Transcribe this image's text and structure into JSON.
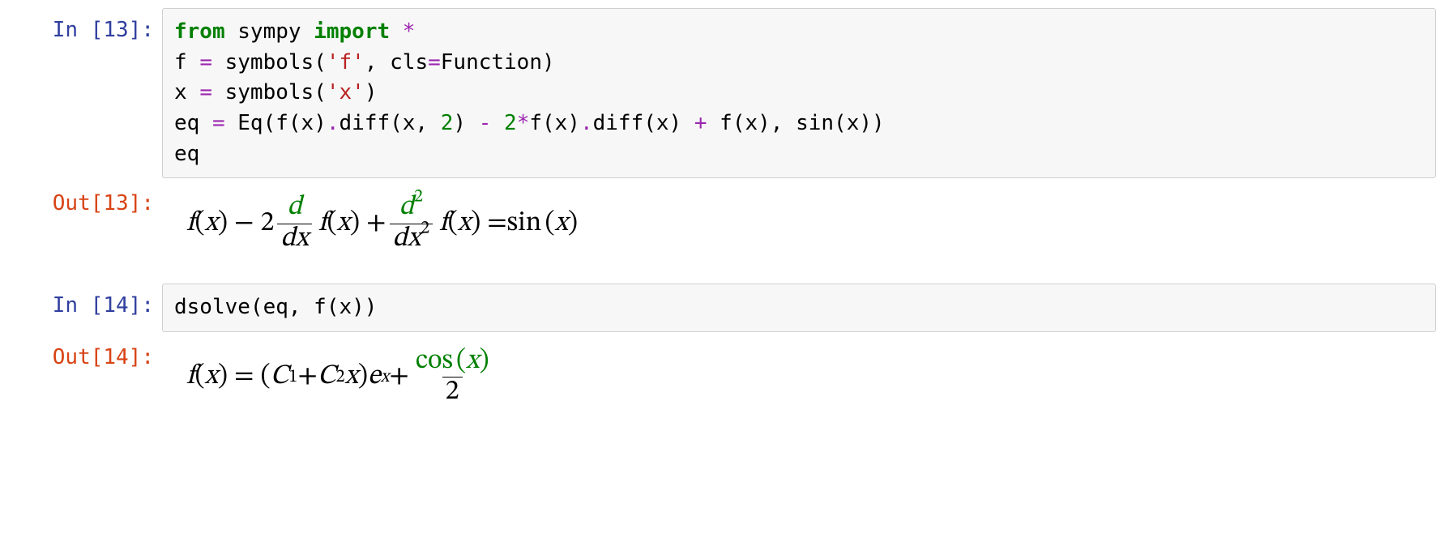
{
  "cells": {
    "c1": {
      "in_prompt": "In [13]:",
      "out_prompt": "Out[13]:",
      "code": {
        "l1": {
          "kw1": "from",
          "mod": " sympy ",
          "kw2": "import",
          "star": " *"
        },
        "l2": {
          "a": "f ",
          "op": "=",
          "b": " symbols(",
          "s": "'f'",
          "c": ", cls",
          "op2": "=",
          "d": "Function)"
        },
        "l3": {
          "a": "x ",
          "op": "=",
          "b": " symbols(",
          "s": "'x'",
          "c": ")"
        },
        "l4": {
          "a": "eq ",
          "op1": "=",
          "b": " Eq(f(x)",
          "op2": ".",
          "c": "diff(x, ",
          "n1": "2",
          "d": ") ",
          "op3": "-",
          "e": " ",
          "n2": "2",
          "op4": "*",
          "f": "f(x)",
          "op5": ".",
          "g": "diff(x) ",
          "op6": "+",
          "h": " f(x), sin(x))"
        },
        "l5": {
          "a": "eq"
        }
      },
      "math": {
        "t1": "f",
        "t2": "(",
        "t3": "x",
        "t4": ") − 2",
        "fr1n": "d",
        "fr1d_a": "d",
        "fr1d_b": "x",
        "t5": "f",
        "t6": "(",
        "t7": "x",
        "t8": ") + ",
        "fr2n_a": "d",
        "fr2n_sup": "2",
        "fr2d_a": "d",
        "fr2d_b": "x",
        "fr2d_sup": "2",
        "t9": "f",
        "t10": "(",
        "t11": "x",
        "t12": ") = ",
        "sin": "sin",
        "t13": "(",
        "t14": "x",
        "t15": ")"
      }
    },
    "c2": {
      "in_prompt": "In [14]:",
      "out_prompt": "Out[14]:",
      "code": {
        "l1": {
          "a": "dsolve(eq, f(x))"
        }
      },
      "math": {
        "t1": "f",
        "t2": "(",
        "t3": "x",
        "t4": ") = (",
        "t5": "C",
        "sub1": "1",
        "t6": " + ",
        "t7": "C",
        "sub2": "2",
        "t8": "x",
        "t9": ") ",
        "t10": "e",
        "supx": "x",
        "t11": " + ",
        "frn_a": "cos",
        "frn_b": "(",
        "frn_c": "x",
        "frn_d": ")",
        "frd": "2"
      }
    }
  }
}
